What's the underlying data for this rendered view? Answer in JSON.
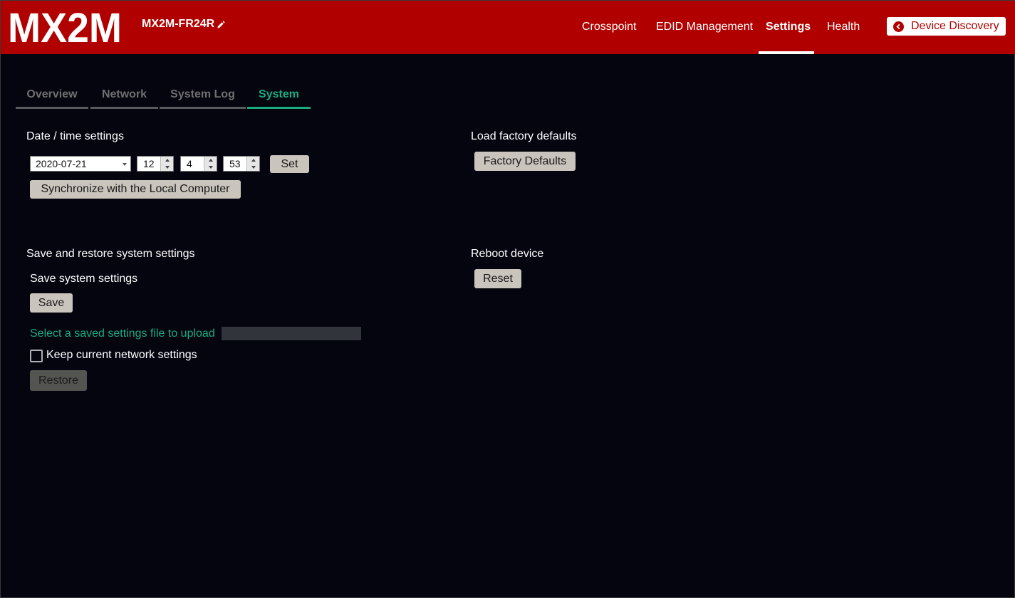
{
  "header": {
    "logo_text": "MX2M",
    "device_name": "MX2M-FR24R",
    "nav": [
      {
        "label": "Crosspoint",
        "active": false
      },
      {
        "label": "EDID Management",
        "active": false
      },
      {
        "label": "Settings",
        "active": true
      },
      {
        "label": "Health",
        "active": false
      }
    ],
    "discovery_label": "Device Discovery"
  },
  "tabs": [
    {
      "label": "Overview",
      "active": false
    },
    {
      "label": "Network",
      "active": false
    },
    {
      "label": "System Log",
      "active": false
    },
    {
      "label": "System",
      "active": true
    }
  ],
  "datetime": {
    "title": "Date / time settings",
    "date": "2020-07-21",
    "hour": "12",
    "minute": "4",
    "second": "53",
    "set_label": "Set",
    "sync_label": "Synchronize with the Local Computer"
  },
  "factory": {
    "title": "Load factory defaults",
    "button_label": "Factory Defaults"
  },
  "save_restore": {
    "title": "Save and restore system settings",
    "save_title": "Save system settings",
    "save_label": "Save",
    "upload_label": "Select a saved settings file to upload",
    "keep_network_label": "Keep current network settings",
    "keep_network_checked": false,
    "restore_label": "Restore"
  },
  "reboot": {
    "title": "Reboot device",
    "reset_label": "Reset"
  },
  "colors": {
    "header_bg": "#b10000",
    "page_bg": "#04050f",
    "accent_green": "#1aab7f",
    "button_bg": "#c9c4bc"
  }
}
